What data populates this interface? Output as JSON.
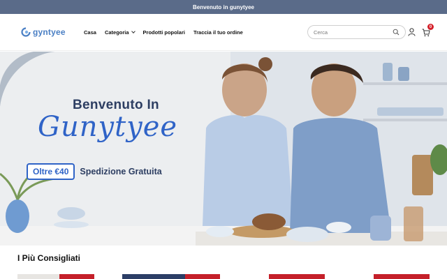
{
  "announcement": "Benvenuto in gunytyee",
  "brand": {
    "name": "gyntyee",
    "color": "#4a7fc4"
  },
  "nav": [
    {
      "label": "Casa"
    },
    {
      "label": "Categoria",
      "has_dropdown": true
    },
    {
      "label": "Prodotti popolari"
    },
    {
      "label": "Traccia il tuo ordine"
    }
  ],
  "search": {
    "placeholder": "Cerca",
    "icon": "search-icon"
  },
  "icons": {
    "account": "user-icon",
    "cart": "cart-icon"
  },
  "cart": {
    "count": "0",
    "badge_color": "#d4202a"
  },
  "hero": {
    "title": "Benvenuto In",
    "script_title": "Gunytyee",
    "promo_highlight": "Oltre €40",
    "promo_text": "Spedizione Gratuita",
    "accent_color": "#2f63c7"
  },
  "section": {
    "title": "I Più Consigliati"
  },
  "colors": {
    "announcement_bar": "#5a6b89",
    "product_tag": "#c5202a"
  }
}
